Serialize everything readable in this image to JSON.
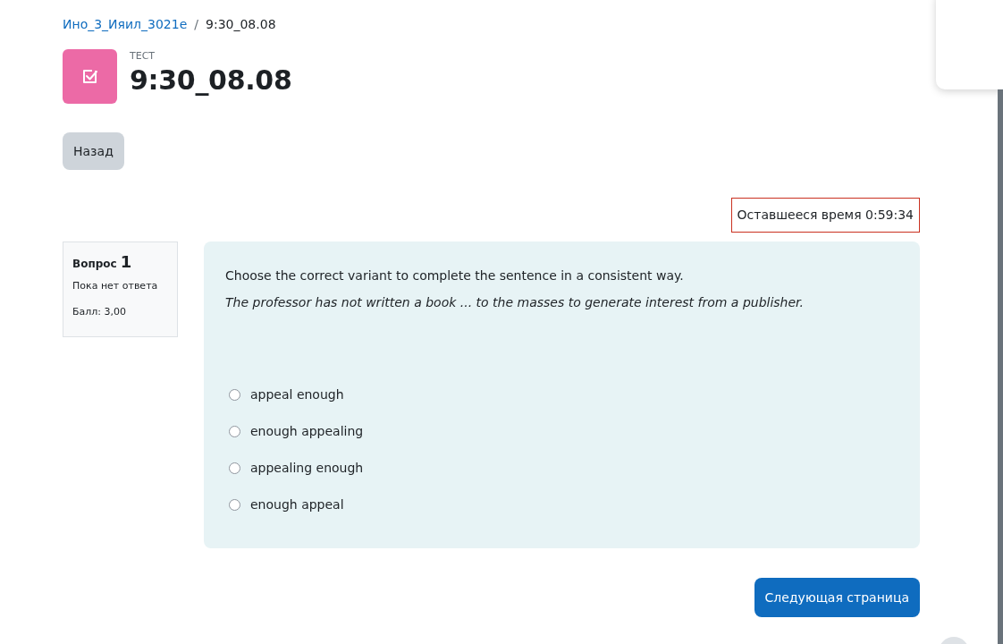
{
  "breadcrumb": {
    "course": "Ино_3_Ияил_3021е",
    "separator": "/",
    "current": "9:30_08.08"
  },
  "header": {
    "kind_label": "ТЕСТ",
    "title": "9:30_08.08"
  },
  "back_button": "Назад",
  "timer": "Оставшееся время 0:59:34",
  "question_info": {
    "label": "Вопрос",
    "number": "1",
    "status": "Пока нет ответа",
    "grade": "Балл: 3,00"
  },
  "question": {
    "prompt": "Choose the correct variant to complete the sentence in a consistent way.",
    "sentence": "The professor has not written a book ... to the masses to generate interest from a publisher.",
    "options": [
      {
        "label": "appeal enough",
        "selected": false
      },
      {
        "label": "enough appealing",
        "selected": false
      },
      {
        "label": "appealing enough",
        "selected": false
      },
      {
        "label": "enough appeal",
        "selected": false
      }
    ]
  },
  "next_button": "Следующая страница"
}
